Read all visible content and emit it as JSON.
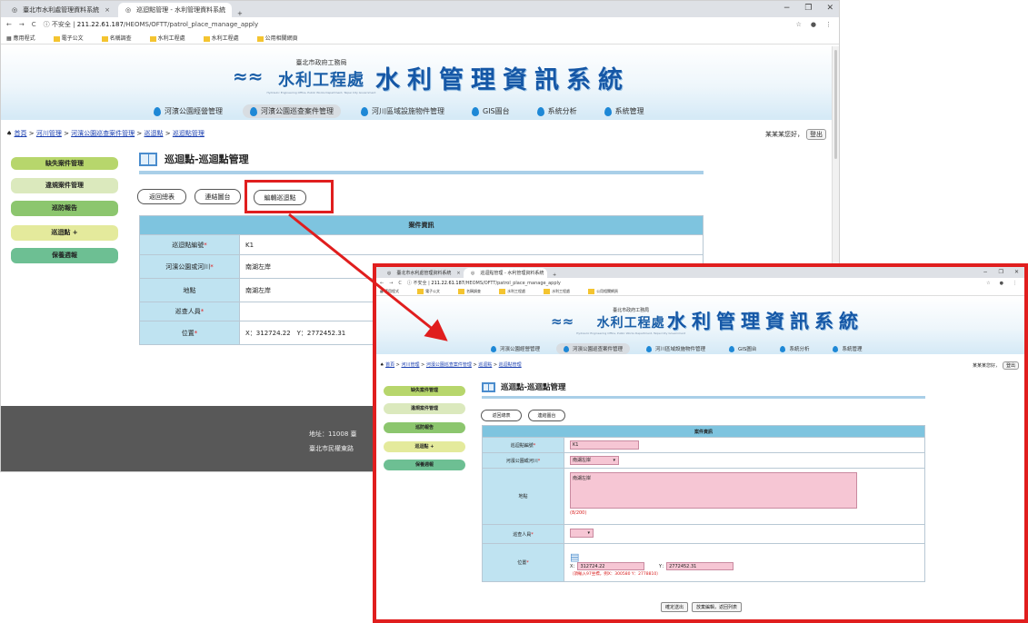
{
  "browser": {
    "tabs": [
      "臺北市水利處管理資料系統",
      "巡迴點管理 - 水利管理資料系統"
    ],
    "url_prefix": "不安全",
    "url_host": "211.22.61.187",
    "url_path": "/HEOMS/OFTT/patrol_place_manage_apply",
    "bookmarks": [
      "應用程式",
      "電子公文",
      "名稱調查",
      "水利工程處",
      "水利工程處",
      "公用相關網頁"
    ]
  },
  "banner": {
    "org_small": "臺北市政府工務局",
    "org_big": "水利工程處",
    "org_tiny": "Hydraulic Engineering Office, Public Works Department, Taipei City Government",
    "system_title": "水利管理資訊系統"
  },
  "nav": [
    {
      "label": "河濱公園經營管理",
      "active": false
    },
    {
      "label": "河濱公園巡查案件管理",
      "active": true
    },
    {
      "label": "河川區域設施物件管理",
      "active": false
    },
    {
      "label": "GIS圖台",
      "active": false
    },
    {
      "label": "系統分析",
      "active": false
    },
    {
      "label": "系統管理",
      "active": false
    }
  ],
  "breadcrumb": {
    "home_icon": "home-icon",
    "items": [
      "首頁",
      "河川管理",
      "河濱公園巡查案件管理",
      "巡迴點",
      "巡迴點管理"
    ]
  },
  "user": {
    "greeting": "某某某您好，",
    "logout": "登出"
  },
  "sidebar": [
    "缺失案件管理",
    "違規案件管理",
    "巡防報告",
    "巡迴點 +",
    "保養週報"
  ],
  "page": {
    "title": "巡迴點-巡迴點管理"
  },
  "actions": {
    "back": "返回總表",
    "map": "連結圖台",
    "edit": "編輯巡迴點"
  },
  "case_info": {
    "caption": "案件資訊",
    "required_mark": "*",
    "labels": {
      "code": "巡迴點編號",
      "park": "河濱公園或河川",
      "address": "地點",
      "staff": "巡查人員",
      "position": "位置"
    },
    "values": {
      "code": "K1",
      "park": "南湖左岸",
      "address": "南湖左岸",
      "staff": "",
      "position": "X：312724.22　Y：2772452.31"
    }
  },
  "edit_form": {
    "x_label": "X：",
    "y_label": "Y：",
    "x_value": "312724.22",
    "y_value": "2772452.31",
    "hint": "（須輸入97坐標，例X：300580 Y：2778810）",
    "char_count": "(8/200)",
    "submit": "確定送出",
    "cancel": "放棄編輯，返回列表"
  },
  "footer": {
    "line1": "地址：11008 臺",
    "line2": "臺北市民權東路"
  },
  "colors": {
    "highlight": "#e01e1e",
    "caption_bg": "#7ec4df",
    "label_bg": "#bfe3f1",
    "required_field": "#f6c6d4"
  }
}
